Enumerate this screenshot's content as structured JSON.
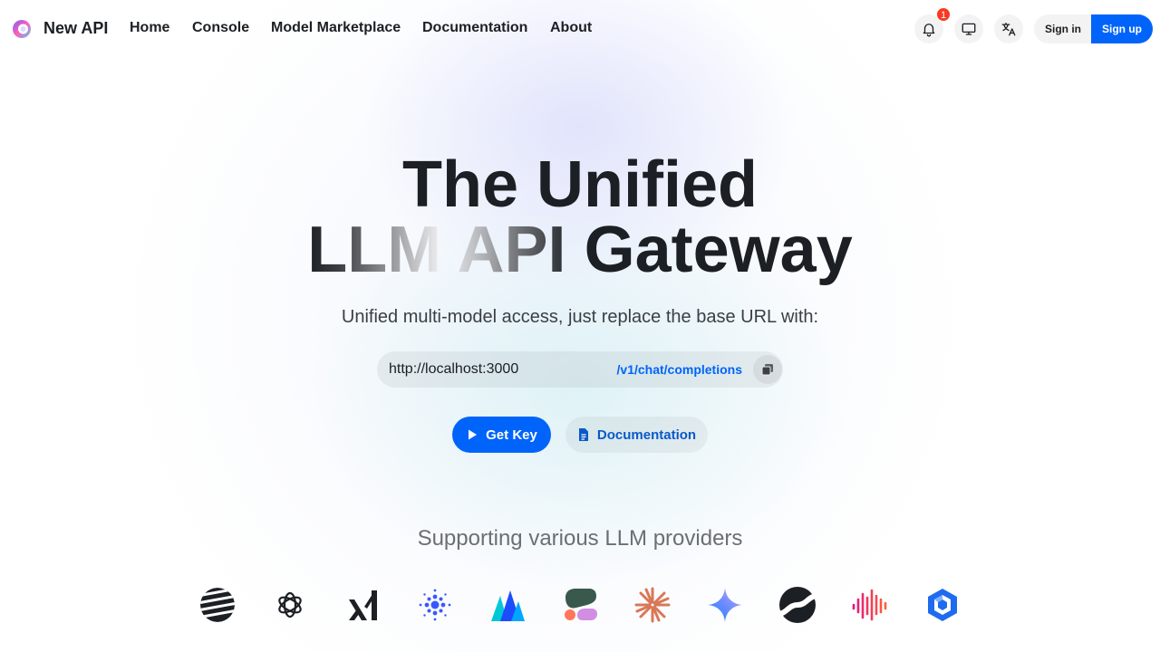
{
  "nav": {
    "brand": "New API",
    "links": [
      "Home",
      "Console",
      "Model Marketplace",
      "Documentation",
      "About"
    ],
    "notification_count": "1",
    "signin_label": "Sign in",
    "signup_label": "Sign up"
  },
  "hero": {
    "title_line1": "The Unified",
    "title_line2_a": "LLM",
    "title_line2_b": "API",
    "title_line2_c": "Gateway",
    "subtitle": "Unified multi-model access, just replace the base URL with:",
    "base_url": "http://localhost:3000",
    "endpoint": "/v1/chat/completions",
    "get_key_label": "Get Key",
    "docs_label": "Documentation"
  },
  "providers": {
    "heading": "Supporting various LLM providers",
    "icons": [
      "moonshot-icon",
      "openai-icon",
      "xai-icon",
      "zhipu-icon",
      "volcengine-icon",
      "cohere-icon",
      "claude-icon",
      "gemini-icon",
      "suno-icon",
      "minimax-icon",
      "wenxin-icon"
    ]
  },
  "colors": {
    "accent": "#0064fa",
    "text": "#1c1f23",
    "badge": "#f93920"
  }
}
